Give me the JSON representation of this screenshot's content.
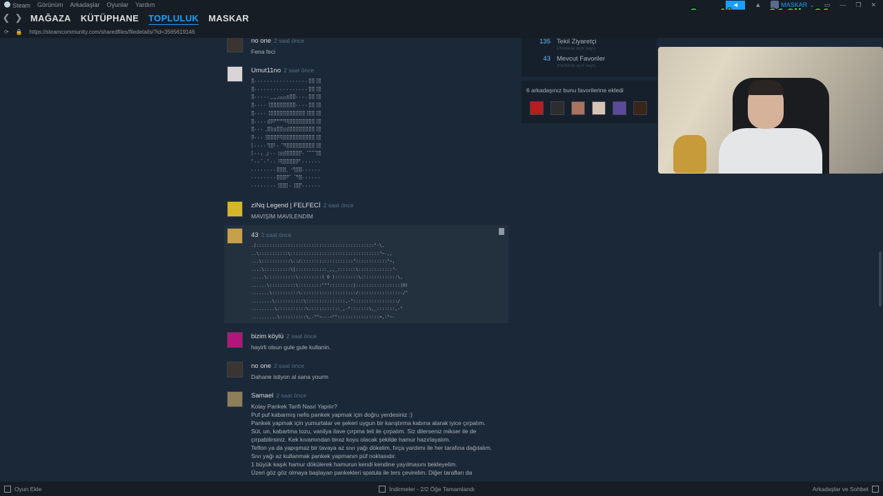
{
  "window": {
    "menu": [
      "Steam",
      "Görünüm",
      "Arkadaşlar",
      "Oyunlar",
      "Yardım"
    ],
    "user_name": "MASKAR"
  },
  "nav": {
    "links": [
      "MAĞAZA",
      "KÜTÜPHANE",
      "TOPLULUK",
      "MASKAR"
    ],
    "active_index": 2
  },
  "url": "https://steamcommunity.com/sharedfiles/filedetails/?id=3565619146",
  "overlay": "Son Abone: 21Cibo21",
  "stats": [
    {
      "num": "135",
      "label": "Tekil Ziyaretçi",
      "sub": "(Herkese açık sayı)"
    },
    {
      "num": "43",
      "label": "Mevcut Favoriler",
      "sub": "(Herkese açık sayı)"
    }
  ],
  "friends_fav": "6 arkadaşınız bunu favorilerine ekledi",
  "comments": [
    {
      "author": "no one",
      "time": "2 saat önce",
      "text": "Fena feci"
    },
    {
      "author": "Umut11no",
      "time": "2 saat önce",
      "ascii": "⣿⠄⠄⠄⠄⠄⠄⠄⠄⠄⠄⠄⠄⠄⠄⠄⠄⠄⣿⣿⢸⣿\n⣿⠄⠄⠄⠄⠄⠄⠄⠄⠄⠄⠄⠄⠄⠄⠄⠄⠄⣿⣿⢸⣿\n⣿⠄⠄⠄⠄⠄⣀⣀⣠⣤⣤⣶⣿⣿⠄⠄⠄⠄⣿⣿⢸⣿\n⣿⠄⠄⠄⠄⢸⣿⣿⣿⣿⣿⣿⣿⣿⠄⠄⠄⠄⣿⣿⢸⣿\n⣿⠄⠄⠄⠄⢸⣿⣿⣿⣿⣿⣿⣿⣿⣿⣿⣿⢸⣿⣿⢸⣿\n⣿⠄⠄⠄⠄⣾⡿⠟⠛⠛⠻⢿⣿⣿⣿⣿⣿⣿⣿⣿⢸⣿\n⣿⠄⠄⠄⢀⣿⣷⣶⣿⣿⣶⣾⣿⣿⣿⣿⣿⣿⣿⣿⢸⣿\n⡿⠄⠄⠄⢸⣿⣿⣿⡿⢿⣿⣿⣿⣿⣿⣿⣿⣿⣿⣿⢸⣿\n⡇⠄⠄⠄⠄⢻⣿⠇⠄⠈⠻⣿⣿⣿⣿⣿⣿⣿⣿⣿⢸⣿\n⡇⠄⠄⡄⢀⡆⠄⠄⢰⣶⣾⣿⣿⣿⣿⡟⠄⠈⠉⠉⢹⣿\n⠃⠄⠄⠁⠄⠃⠄⠄⠸⢿⣿⣿⣿⣿⡿⠃⠄⠄⠄⠄⠄⠄\n⠄⠄⠄⠄⠄⠄⠄⠄⣿⣿⣿⡀⠐⢻⣿⣿⠄⠄⠄⠄⠄⠄\n⠄⠄⠄⠄⠄⠄⠄⠄⣿⣿⣿⠟⠁⠈⠻⣿⠄⠄⠄⠄⠄⠄\n⠄⠄⠄⠄⠄⠄⠄⠄⢸⣿⣿⡇⠄⢸⣿⡟⠄⠄⠄⠄⠄⠄"
    },
    {
      "author": "zINq Legend | FELFECİ",
      "time": "2 saat önce",
      "text": "MAVİŞİM MAVİLENDİM"
    },
    {
      "author": "43",
      "time": "2 saat önce",
      "ascii": ".|:::::::::::::::::::::::::::::::::::::::::::::\"-\\,\n..\\:::::::::::\\::::::::::::::::::::::::::::::::::\"~-,,\n...\\:::::::::::\\::/::::::::::::::::::::\"::::::::::::\"~,\n....\\::::::::::\\|::::::::::::_,,_:::::::\\:::::::::::::\"-\n.....\\:::::::::::\\:::::::::( O ):::::::::\\::::::::::::::\\,\n......\\::::::::::\\:::::::::\"\"\":::::::::|:::::::::::::::::|O)\n.......\\::::::::::\\:::::::::::::::::::::/:::::::::::::::::/\"\n........\\:::::::::::\\:::::::::::::::,-\":::::::::::::::::/\n.........\\:::::::::::\\::::::::::::_,-\":::::::\\,_:::::::,-\"\n..........\\::::::::::\\,-\"\"~---~\"\"::::::::::::::::=,:\"~-"
    },
    {
      "author": "bizim köylü",
      "time": "2 saat önce",
      "text": "hayirli olsun gule gule kullanin."
    },
    {
      "author": "no one",
      "time": "2 saat önce",
      "text": "Dahane istiyon al sana yourm"
    },
    {
      "author": "Samael",
      "time": "2 saat önce",
      "text": "Kolay Pankek Tarifi Nasıl Yapılır?\nPuf puf kabarmış nefis pankek yapmak için doğru yerdesiniz :)\nPankek yapmak için yumurtalar ve şekeri uygun bir karıştırma kabına alarak iyice çırpalım.\nSüt, un, kabartma tozu, vanilya ilave çırpma teli ile çırpalım. Siz dilerseniz mikser ile de çırpabilirsiniz. Kek kıvamından biraz koyu olacak şekilde hamur hazırlayalım.\nTeflon ya da yapışmaz bir tavaya az sıvı yağı dökelim, fırça yardımı ile her tarafına dağıtalım. Sıvı yağı az kullanmak pankek yapmanın püf noktasıdır.\n1 büyük kaşık hamur dökülerek hamurun kendi kendine yayılmasını bekleyelim.\nÜzeri göz göz olmaya başlayan pankekleri spatula ile ters çevirelim. Diğer tarafları da"
    }
  ],
  "bottom": {
    "add_game": "Oyun Ekle",
    "downloads": "İndirmeler - 2/2 Öğe Tamamlandı",
    "friends_chat": "Arkadaşlar ve Sohbet"
  }
}
